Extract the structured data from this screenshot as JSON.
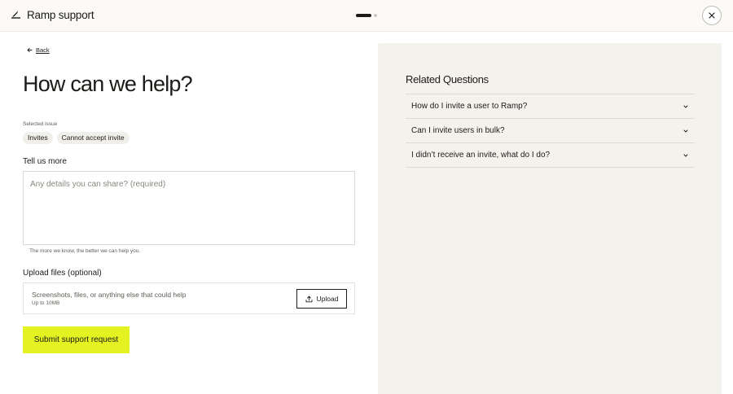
{
  "header": {
    "title": "Ramp support",
    "logo_icon": "ramp-logo-icon",
    "progress": {
      "current_step": 1,
      "total_steps": 2
    },
    "close_icon": "close-icon"
  },
  "nav": {
    "back_label": "Back",
    "back_icon": "arrow-left-icon"
  },
  "main": {
    "title": "How can we help?",
    "selected_issue_label": "Selected issue",
    "selected_issue_chips": [
      "Invites",
      "Cannot accept invite"
    ],
    "details": {
      "label": "Tell us more",
      "placeholder": "Any details you can share? (required)",
      "value": "",
      "helper": "The more we know, the better we can help you."
    },
    "upload": {
      "label": "Upload files (optional)",
      "description": "Screenshots, files, or anything else that could help",
      "limit": "Up to 10MB",
      "button_label": "Upload",
      "button_icon": "upload-icon"
    },
    "submit_label": "Submit support request"
  },
  "related": {
    "title": "Related Questions",
    "questions": [
      {
        "text": "How do I invite a user to Ramp?"
      },
      {
        "text": "Can I invite users in bulk?"
      },
      {
        "text": "I didn’t receive an invite, what do I do?"
      }
    ]
  },
  "colors": {
    "accent": "#e4f222",
    "text": "#1c1b18",
    "panel_bg": "#f4f2ed",
    "topbar_bg": "#fbfaf7"
  }
}
